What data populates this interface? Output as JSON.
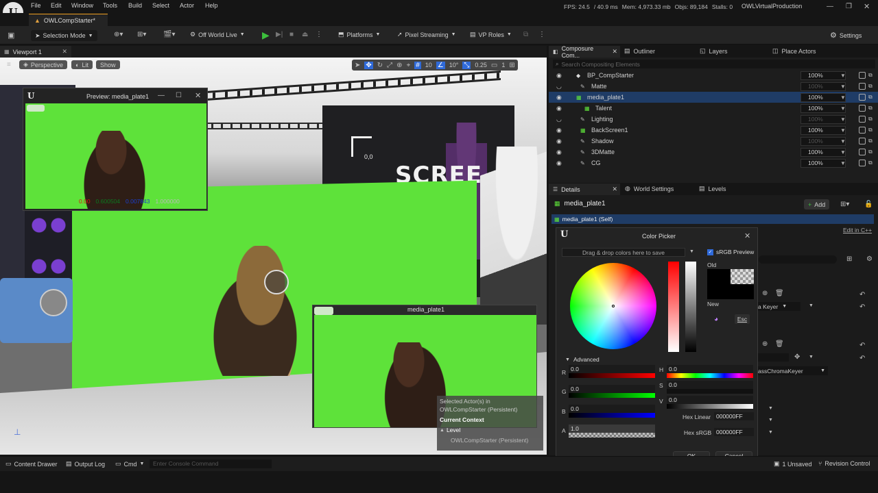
{
  "menu": [
    "File",
    "Edit",
    "Window",
    "Tools",
    "Build",
    "Select",
    "Actor",
    "Help"
  ],
  "stats": {
    "fps": "FPS: 24.5",
    "ms": "/ 40.9 ms",
    "mem": "Mem: 4,973.33 mb",
    "objs": "Objs: 89,184",
    "stalls": "Stalls: 0"
  },
  "project_name": "OWLVirtualProduction",
  "level_tab": "OWLCompStarter*",
  "toolbar": {
    "mode": "Selection Mode",
    "world": "Off World Live",
    "platforms": "Platforms",
    "pixel_streaming": "Pixel Streaming",
    "vp_roles": "VP Roles",
    "settings": "Settings"
  },
  "viewport": {
    "tab": "Viewport 1",
    "perspective": "Perspective",
    "lit": "Lit",
    "show": "Show",
    "grid_val": "10",
    "rot_val": "10°",
    "scale_val": "0.25",
    "cam_speed": "1",
    "coord": "0,0",
    "screen_text": "SCREE",
    "preview_title": "Preview: media_plate1",
    "preview_values": [
      "0.00",
      "0.600504",
      "0.007843",
      "1.000000"
    ],
    "media_label": "media_plate1",
    "context": {
      "line1": "Selected Actor(s) in",
      "line2": "OWLCompStarter (Persistent)",
      "current": "Current Context",
      "level": "Level",
      "level_value": "OWLCompStarter (Persistent)"
    }
  },
  "outliner": {
    "tabs": [
      "Composure Com...",
      "Outliner",
      "Layers",
      "Place Actors"
    ],
    "search_placeholder": "Search Compositing Elements",
    "rows": [
      {
        "name": "BP_CompStarter",
        "pct": "100%",
        "dim": false
      },
      {
        "name": "Matte",
        "pct": "100%",
        "dim": true
      },
      {
        "name": "media_plate1",
        "pct": "100%",
        "dim": false
      },
      {
        "name": "Talent",
        "pct": "100%",
        "dim": false
      },
      {
        "name": "Lighting",
        "pct": "100%",
        "dim": true
      },
      {
        "name": "BackScreen1",
        "pct": "100%",
        "dim": false
      },
      {
        "name": "Shadow",
        "pct": "100%",
        "dim": true
      },
      {
        "name": "3DMatte",
        "pct": "100%",
        "dim": false
      },
      {
        "name": "CG",
        "pct": "100%",
        "dim": false
      }
    ]
  },
  "details": {
    "tabs": [
      "Details",
      "World Settings",
      "Levels"
    ],
    "title": "media_plate1",
    "add": "Add",
    "self": "media_plate1 (Self)",
    "edit_cpp": "Edit in C++",
    "keyer": "a Keyer",
    "chroma": "assChromaKeyer"
  },
  "color_picker": {
    "title": "Color Picker",
    "drag_hint": "Drag & drop colors here to save",
    "srgb_preview": "sRGB Preview",
    "old": "Old",
    "new": "New",
    "esc": "Esc",
    "advanced": "Advanced",
    "r_label": "R",
    "g_label": "G",
    "b_label": "B",
    "a_label": "A",
    "h_label": "H",
    "s_label": "S",
    "v_label": "V",
    "r": "0.0",
    "g": "0.0",
    "b": "0.0",
    "a": "1.0",
    "h": "0.0",
    "s": "0.0",
    "v": "0.0",
    "hex_linear_label": "Hex Linear",
    "hex_linear": "000000FF",
    "hex_srgb_label": "Hex sRGB",
    "hex_srgb": "000000FF",
    "ok": "OK",
    "cancel": "Cancel"
  },
  "statusbar": {
    "content_drawer": "Content Drawer",
    "output_log": "Output Log",
    "cmd": "Cmd",
    "console_placeholder": "Enter Console Command",
    "unsaved": "1 Unsaved",
    "revision": "Revision Control"
  },
  "colors": {
    "green_screen": "#5ee23a",
    "accent": "#2f6ad9",
    "selection": "#1f3c66"
  }
}
